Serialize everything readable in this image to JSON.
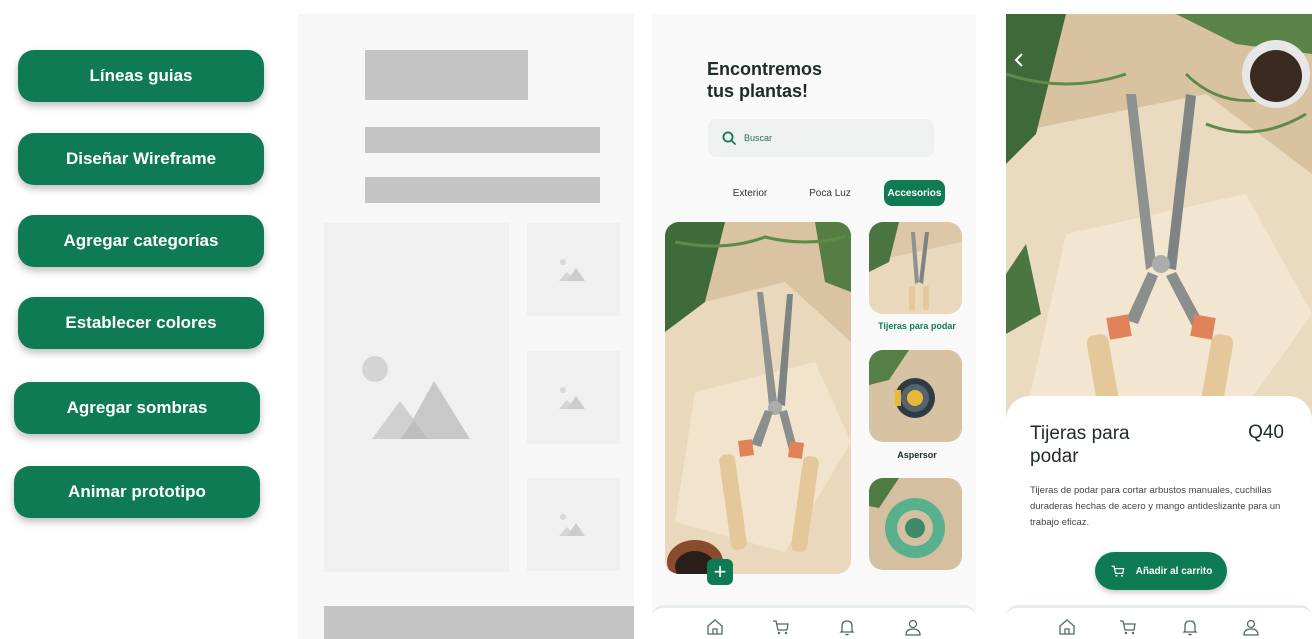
{
  "steps": {
    "items": [
      "Líneas guias",
      "Diseñar Wireframe",
      "Agregar categorías",
      "Establecer colores",
      "Agregar sombras",
      "Animar prototipo"
    ]
  },
  "browse": {
    "title_line1": "Encontremos",
    "title_line2": "tus plantas!",
    "search_placeholder": "Buscar",
    "tabs": [
      "Exterior",
      "Poca Luz",
      "Accesorios"
    ],
    "active_tab": "Accesorios",
    "products": [
      "Tijeras para podar",
      "Aspersor"
    ],
    "add_label": "+"
  },
  "detail": {
    "name": "Tijeras para podar",
    "price": "Q40",
    "description": "Tijeras de podar para cortar arbustos manuales, cuchillas duraderas hechas de acero y mango antideslizante para un trabajo eficaz.",
    "cart_label": "Añadir al carrito"
  },
  "nav": {
    "items": [
      "home-icon",
      "cart-icon",
      "bell-icon",
      "user-icon"
    ]
  },
  "colors": {
    "accent": "#0f7b55",
    "wire_gray": "#c4c4c4"
  }
}
